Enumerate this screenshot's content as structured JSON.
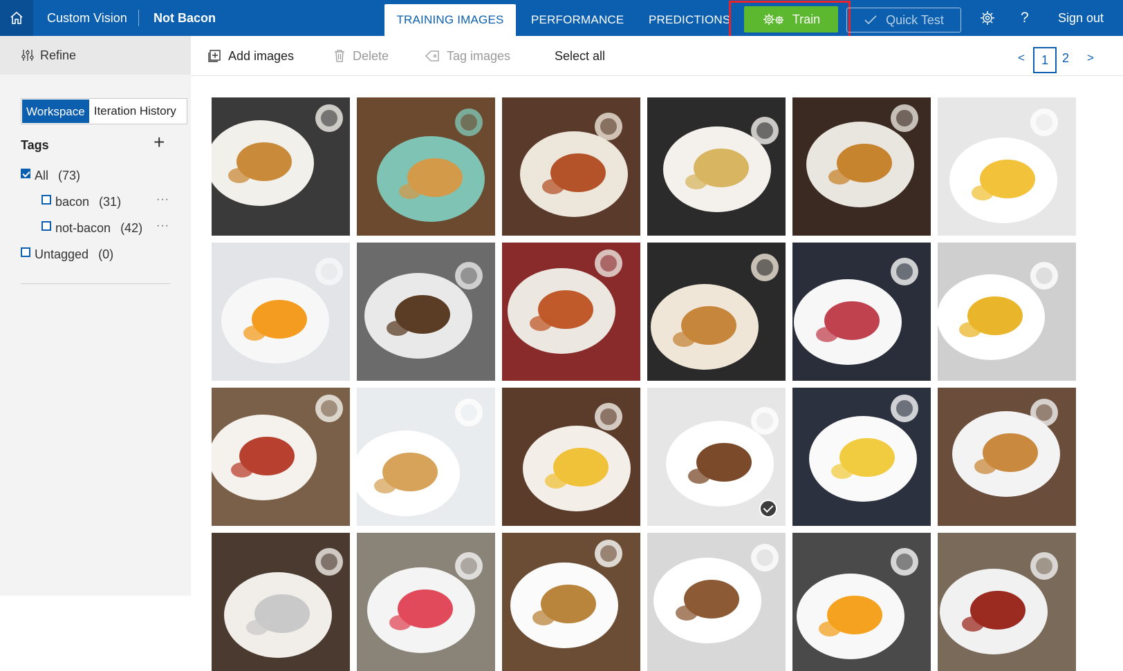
{
  "topbar": {
    "brand": "Custom Vision",
    "project": "Not Bacon",
    "tabs": [
      {
        "label": "TRAINING IMAGES",
        "active": true
      },
      {
        "label": "PERFORMANCE",
        "active": false
      },
      {
        "label": "PREDICTIONS",
        "active": false
      }
    ],
    "train_label": "Train",
    "quick_test_label": "Quick Test",
    "help_label": "?",
    "signout_label": "Sign out",
    "colors": {
      "bar": "#0b5fae",
      "train": "#5cb82e",
      "highlight": "#e8232a"
    }
  },
  "sidebar": {
    "refine_label": "Refine",
    "segments": [
      "Workspace",
      "Iteration History"
    ],
    "tags_title": "Tags",
    "tags": [
      {
        "label": "All",
        "count": "(73)",
        "checked": true
      },
      {
        "label": "bacon",
        "count": "(31)",
        "checked": false
      },
      {
        "label": "not-bacon",
        "count": "(42)",
        "checked": false
      },
      {
        "label": "Untagged",
        "count": "(0)",
        "checked": false
      }
    ],
    "more_label": "···"
  },
  "toolbar": {
    "add_images": "Add images",
    "delete": "Delete",
    "tag_images": "Tag images",
    "select_all": "Select all"
  },
  "pagination": {
    "prev": "<",
    "pages": [
      "1",
      "2"
    ],
    "current": "1",
    "next": ">"
  },
  "images": {
    "count_visible": 24,
    "selected_index": 15,
    "icons": [
      "home-icon",
      "refine-icon",
      "add-images-icon",
      "delete-icon",
      "tag-icon",
      "gear-icon",
      "check-icon"
    ]
  }
}
